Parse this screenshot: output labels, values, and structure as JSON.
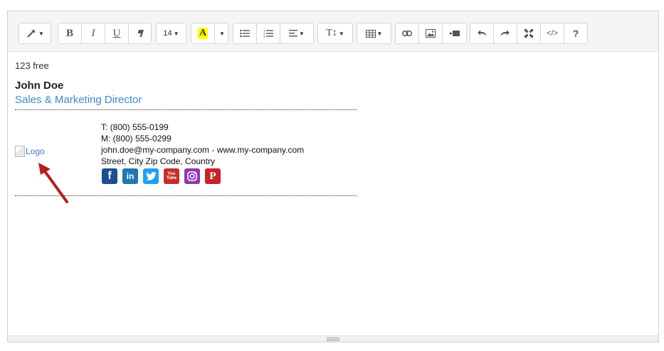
{
  "toolbar": {
    "font_size": "14",
    "icons": {
      "magic": "magic-wand-icon",
      "bold": "B",
      "italic": "I",
      "underline": "U",
      "eraser": "eraser-icon",
      "highlight": "A",
      "highlight_color": "#ffff00",
      "help": "?",
      "code": "</>",
      "text_style": "T↕"
    }
  },
  "content": {
    "free_text": "123 free",
    "name": "John Doe",
    "title": "Sales & Marketing Director",
    "title_color": "#3a8bc8",
    "logo_alt": "Logo",
    "phone": "T: (800) 555-0199",
    "mobile": "M: (800) 555-0299",
    "email": "john.doe@my-company.com",
    "email_sep": " - ",
    "website": "www.my-company.com",
    "address": "Street, City Zip Code, Country",
    "socials": [
      {
        "name": "facebook",
        "glyph": "f",
        "color": "#1d4e8f"
      },
      {
        "name": "linkedin",
        "glyph": "in",
        "color": "#1e78b4"
      },
      {
        "name": "twitter",
        "glyph": "t",
        "color": "#1da1f2"
      },
      {
        "name": "youtube",
        "glyph": "You Tube",
        "color": "#c4302b"
      },
      {
        "name": "instagram",
        "glyph": "ig",
        "color": "#8a3ab9"
      },
      {
        "name": "pinterest",
        "glyph": "P",
        "color": "#c8232c"
      }
    ],
    "arrow_color": "#b81c1c"
  }
}
